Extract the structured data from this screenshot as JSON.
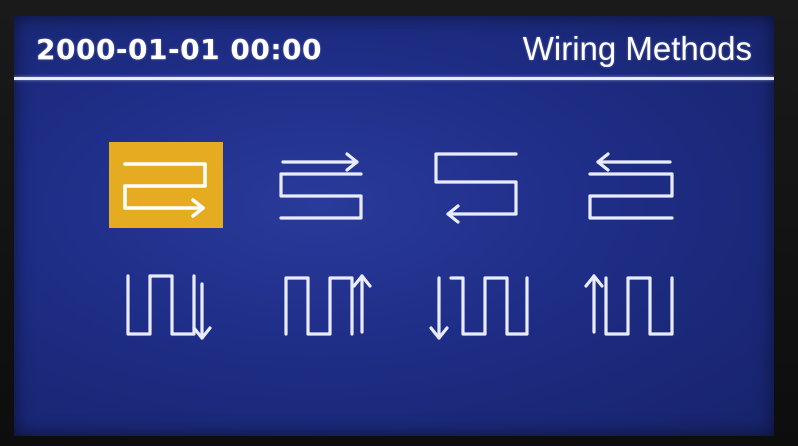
{
  "status_bar": {
    "datetime": "2000-01-01 00:00",
    "title": "Wiring Methods"
  },
  "colors": {
    "background": "#1e2d86",
    "foreground": "#e9ecff",
    "selected_highlight": "#e6ac21"
  },
  "wiring_methods": {
    "selected_index": 0,
    "items": [
      {
        "icon": "serpentine-start-top-right-icon"
      },
      {
        "icon": "serpentine-start-bottom-left-icon"
      },
      {
        "icon": "serpentine-start-bottom-right-icon"
      },
      {
        "icon": "serpentine-start-top-left-icon"
      },
      {
        "icon": "vertical-serpentine-down-icon"
      },
      {
        "icon": "vertical-serpentine-up-icon"
      },
      {
        "icon": "vertical-serpentine-down-left-icon"
      },
      {
        "icon": "vertical-serpentine-up-left-icon"
      }
    ]
  }
}
